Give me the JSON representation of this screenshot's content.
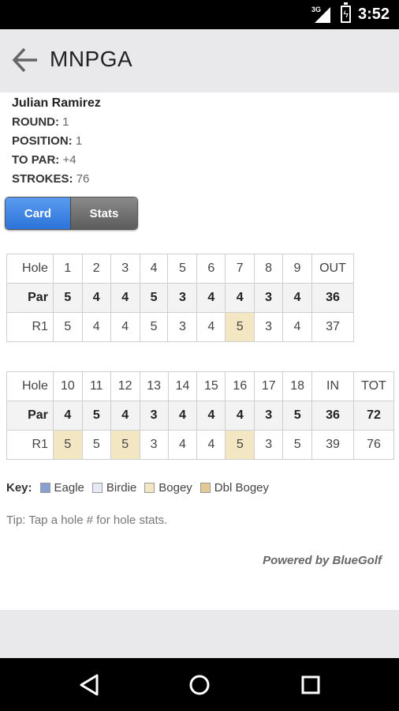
{
  "status": {
    "network": "3G",
    "time": "3:52"
  },
  "appbar": {
    "title": "MNPGA"
  },
  "player": {
    "name": "Julian Ramirez",
    "round_label": "ROUND:",
    "round": "1",
    "position_label": "POSITION:",
    "position": "1",
    "topar_label": "TO PAR:",
    "topar": "+4",
    "strokes_label": "STROKES:",
    "strokes": "76"
  },
  "tabs": {
    "card": "Card",
    "stats": "Stats"
  },
  "front": {
    "hole_label": "Hole",
    "holes": [
      "1",
      "2",
      "3",
      "4",
      "5",
      "6",
      "7",
      "8",
      "9",
      "OUT"
    ],
    "par_label": "Par",
    "par": [
      "5",
      "4",
      "4",
      "5",
      "3",
      "4",
      "4",
      "3",
      "4",
      "36"
    ],
    "r1_label": "R1",
    "r1": [
      "5",
      "4",
      "4",
      "5",
      "3",
      "4",
      "5",
      "3",
      "4",
      "37"
    ],
    "r1_bogey": [
      false,
      false,
      false,
      false,
      false,
      false,
      true,
      false,
      false,
      false
    ]
  },
  "back": {
    "hole_label": "Hole",
    "holes": [
      "10",
      "11",
      "12",
      "13",
      "14",
      "15",
      "16",
      "17",
      "18",
      "IN",
      "TOT"
    ],
    "par_label": "Par",
    "par": [
      "4",
      "5",
      "4",
      "3",
      "4",
      "4",
      "4",
      "3",
      "5",
      "36",
      "72"
    ],
    "r1_label": "R1",
    "r1": [
      "5",
      "5",
      "5",
      "3",
      "4",
      "4",
      "5",
      "3",
      "5",
      "39",
      "76"
    ],
    "r1_bogey": [
      true,
      false,
      true,
      false,
      false,
      false,
      true,
      false,
      false,
      false,
      false
    ]
  },
  "key": {
    "label": "Key:",
    "items": [
      {
        "label": "Eagle",
        "color": "#8a9fd1"
      },
      {
        "label": "Birdie",
        "color": "#e6eaf6"
      },
      {
        "label": "Bogey",
        "color": "#f3e6c2"
      },
      {
        "label": "Dbl Bogey",
        "color": "#e3c993"
      }
    ]
  },
  "tip": "Tip: Tap a hole # for hole stats.",
  "powered": "Powered by BlueGolf",
  "colors": {
    "accent": "#2c73d9",
    "bogey": "#f3e6c2"
  }
}
